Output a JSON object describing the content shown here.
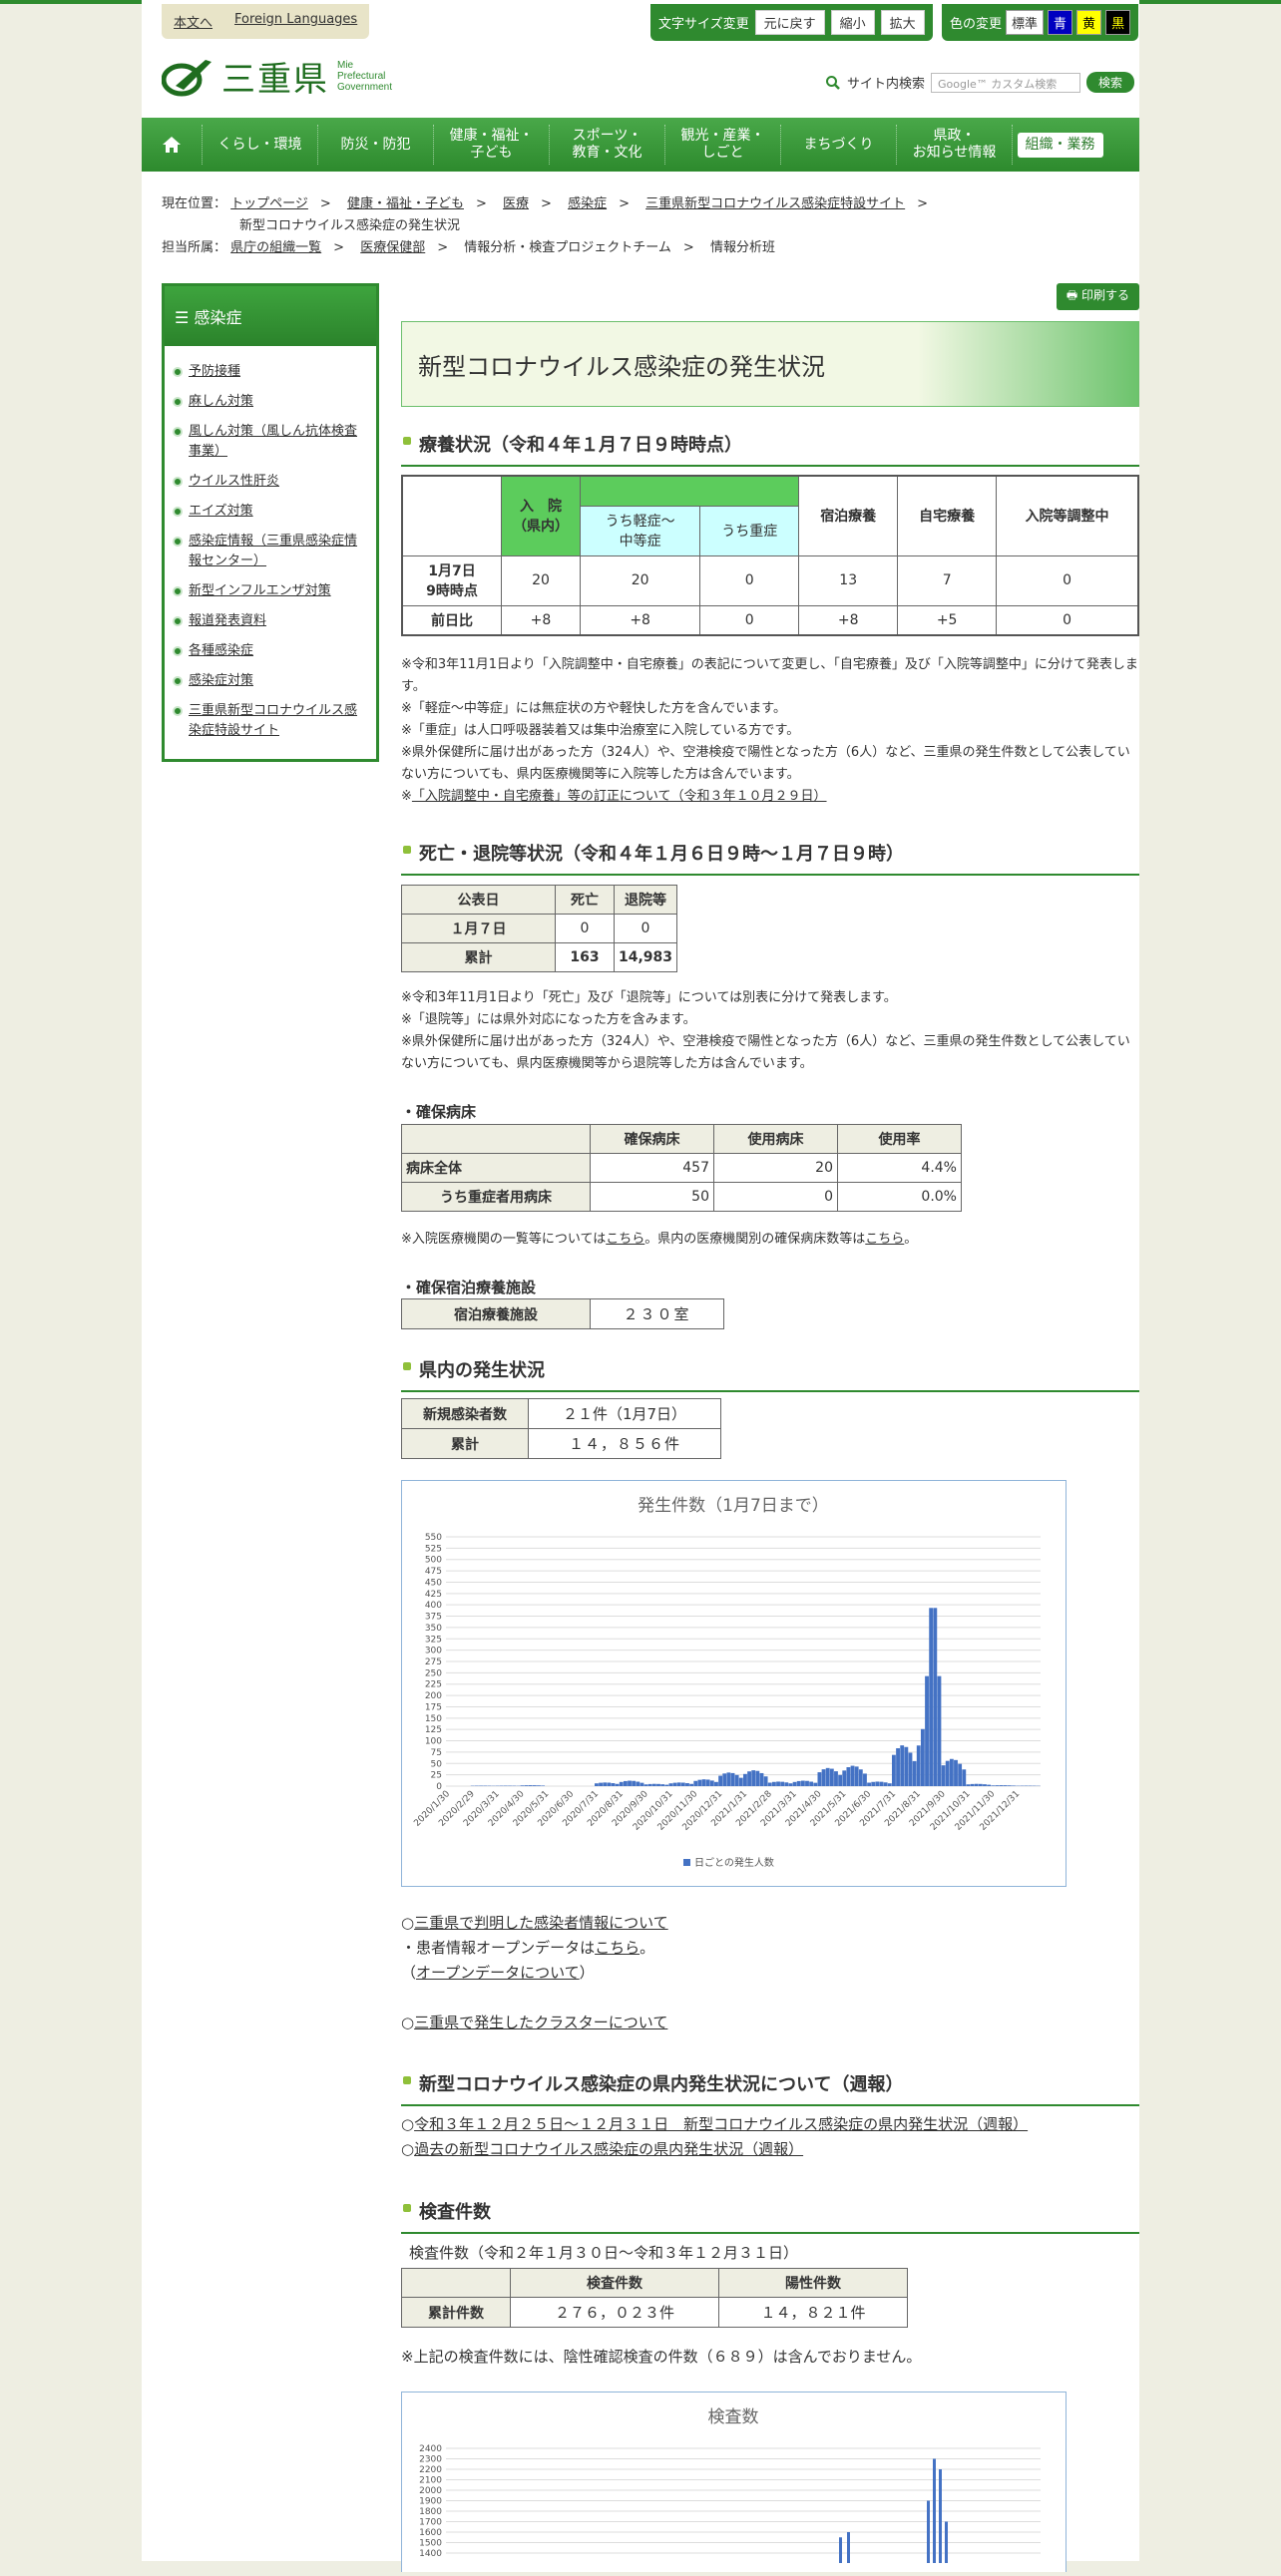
{
  "util": {
    "main_link": "本文へ",
    "foreign": "Foreign Languages",
    "text_size_label": "文字サイズ変更",
    "size_reset": "元に戻す",
    "size_small": "縮小",
    "size_large": "拡大",
    "color_label": "色の変更",
    "color_std": "標準",
    "color_blue": "青",
    "color_yellow": "黄",
    "color_black": "黒"
  },
  "logo": {
    "name": "三重県",
    "sub1": "Mie",
    "sub2": "Prefectural",
    "sub3": "Government"
  },
  "search": {
    "label": "サイト内検索",
    "placeholder": "Google™ カスタム検索",
    "button": "検索"
  },
  "nav": [
    {
      "label1": "くらし・環境",
      "label2": ""
    },
    {
      "label1": "防災・防犯",
      "label2": ""
    },
    {
      "label1": "健康・福祉・",
      "label2": "子ども"
    },
    {
      "label1": "スポーツ・",
      "label2": "教育・文化"
    },
    {
      "label1": "観光・産業・",
      "label2": "しごと"
    },
    {
      "label1": "まちづくり",
      "label2": ""
    },
    {
      "label1": "県政・",
      "label2": "お知らせ情報"
    },
    {
      "label1": "組織・業務",
      "label2": ""
    }
  ],
  "breadcrumb": {
    "current_label": "現在位置：",
    "items": [
      "トップページ",
      "健康・福祉・子ども",
      "医療",
      "感染症",
      "三重県新型コロナウイルス感染症特設サイト"
    ],
    "last": "新型コロナウイルス感染症の発生状況",
    "dept_label": "担当所属：",
    "dept_items": [
      "県庁の組織一覧",
      "医療保健部",
      "情報分析・検査プロジェクトチーム",
      "情報分析班"
    ]
  },
  "sidebar": {
    "title": "感染症",
    "items": [
      "予防接種",
      "麻しん対策",
      "風しん対策（風しん抗体検査事業）",
      "ウイルス性肝炎",
      "エイズ対策",
      "感染症情報（三重県感染症情報センター）",
      "新型インフルエンザ対策",
      "報道発表資料",
      "各種感染症",
      "感染症対策",
      "三重県新型コロナウイルス感染症特設サイト"
    ]
  },
  "main": {
    "print": "印刷する",
    "title": "新型コロナウイルス感染症の発生状況",
    "sec1": {
      "heading": "療養状況（令和４年１月７日９時時点）",
      "hdr_hosp": "入　院\n（県内）",
      "hdr_mild": "うち軽症～\n中等症",
      "hdr_severe": "うち重症",
      "hdr_hotel": "宿泊療養",
      "hdr_home": "自宅療養",
      "hdr_adjust": "入院等調整中",
      "row1_label": "1月7日\n9時時点",
      "row1": [
        "20",
        "20",
        "0",
        "13",
        "7",
        "0"
      ],
      "row2_label": "前日比",
      "row2": [
        "+8",
        "+8",
        "0",
        "+8",
        "+5",
        "0"
      ],
      "notes": [
        "※令和3年11月1日より「入院調整中・自宅療養」の表記について変更し、「自宅療養」及び「入院等調整中」に分けて発表します。",
        "※「軽症～中等症」には無症状の方や軽快した方を含んでいます。",
        "※「重症」は人口呼吸器装着又は集中治療室に入院している方です。",
        "※県外保健所に届け出があった方（324人）や、空港検疫で陽性となった方（6人）など、三重県の発生件数として公表していない方についても、県内医療機関等に入院等した方は含んでいます。"
      ],
      "note_link": "「入院調整中・自宅療養」等の訂正について（令和３年１０月２９日）"
    },
    "sec2": {
      "heading": "死亡・退院等状況（令和４年１月６日９時～１月７日９時）",
      "hdr": [
        "公表日",
        "死亡",
        "退院等"
      ],
      "rows": [
        [
          "１月７日",
          "0",
          "0"
        ],
        [
          "累計",
          "163",
          "14,983"
        ]
      ],
      "notes": [
        "※令和3年11月1日より「死亡」及び「退院等」については別表に分けて発表します。",
        "※「退院等」には県外対応になった方を含みます。",
        "※県外保健所に届け出があった方（324人）や、空港検疫で陽性となった方（6人）など、三重県の発生件数として公表していない方についても、県内医療機関等から退院等した方は含んでいます。"
      ],
      "beds_title": "・確保病床",
      "beds_hdr": [
        "",
        "確保病床",
        "使用病床",
        "使用率"
      ],
      "beds_rows": [
        [
          "病床全体",
          "457",
          "20",
          "4.4%"
        ],
        [
          "うち重症者用病床",
          "50",
          "0",
          "0.0%"
        ]
      ],
      "beds_note_a": "※入院医療機関の一覧等については",
      "beds_note_link1": "こちら",
      "beds_note_b": "。県内の医療機関別の確保病床数等は",
      "beds_note_link2": "こちら",
      "beds_note_c": "。",
      "hotel_title": "・確保宿泊療養施設",
      "hotel_label": "宿泊療養施設",
      "hotel_value": "２３０室"
    },
    "sec3": {
      "heading": "県内の発生状況",
      "new_label": "新規感染者数",
      "new_value": "２１件（1月7日）",
      "total_label": "累計",
      "total_value": "１４，８５６件",
      "link1": "三重県で判明した感染者情報について",
      "opendata_a": "・患者情報オープンデータは",
      "opendata_link": "こちら",
      "opendata_b": "。",
      "opendata_about": "オープンデータについて",
      "link2": "三重県で発生したクラスターについて"
    },
    "sec4": {
      "heading": "新型コロナウイルス感染症の県内発生状況について（週報）",
      "link1": "令和３年１２月２５日～１２月３１日　新型コロナウイルス感染症の県内発生状況（週報）",
      "link2": "過去の新型コロナウイルス感染症の県内発生状況（週報）"
    },
    "sec5": {
      "heading": "検査件数",
      "period": "検査件数（令和２年１月３０日～令和３年１２月３１日）",
      "hdr": [
        "",
        "検査件数",
        "陽性件数"
      ],
      "row_label": "累計件数",
      "row": [
        "２７６，０２３件",
        "１４，８２１件"
      ],
      "note": "※上記の検査件数には、陰性確認検査の件数（６８９）は含んでおりません。"
    }
  },
  "chart_data": [
    {
      "type": "bar",
      "title": "発生件数（1月7日まで）",
      "legend": "日ごとの発生人数",
      "legend_position": "bottom",
      "ylim": [
        0,
        550
      ],
      "yticks": [
        0,
        25,
        50,
        75,
        100,
        125,
        150,
        175,
        200,
        225,
        250,
        275,
        300,
        325,
        350,
        375,
        400,
        425,
        450,
        475,
        500,
        525,
        550
      ],
      "xticks": [
        "2020/1/30",
        "2020/2/29",
        "2020/3/31",
        "2020/4/30",
        "2020/5/31",
        "2020/6/30",
        "2020/7/31",
        "2020/8/31",
        "2020/9/30",
        "2020/10/31",
        "2020/11/30",
        "2020/12/31",
        "2021/1/31",
        "2021/2/28",
        "2021/3/31",
        "2021/4/30",
        "2021/5/31",
        "2021/6/30",
        "2021/7/31",
        "2021/8/31",
        "2021/9/30",
        "2021/10/31",
        "2021/11/30",
        "2021/12/31"
      ],
      "monthly_approx_daily": [
        0,
        1,
        1,
        2,
        0,
        0,
        8,
        12,
        5,
        8,
        15,
        30,
        35,
        10,
        12,
        40,
        45,
        10,
        90,
        420,
        60,
        5,
        2,
        1
      ],
      "color": "#4472c4"
    },
    {
      "type": "bar",
      "title": "検査数",
      "ylim": [
        0,
        2400
      ],
      "yticks": [
        1400,
        1500,
        1600,
        1700,
        1800,
        1900,
        2000,
        2100,
        2200,
        2300,
        2400
      ],
      "peaks_approx": [
        1550,
        1600,
        2300
      ],
      "color": "#4472c4"
    }
  ]
}
